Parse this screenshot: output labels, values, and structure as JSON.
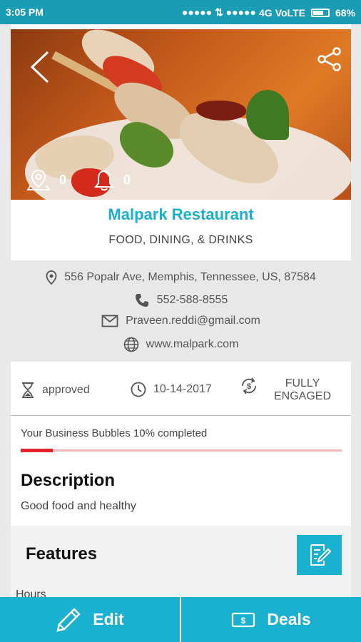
{
  "status_bar": {
    "time": "3:05 PM",
    "signal": "●●●●● ⇅ ●●●●●",
    "network": "4G",
    "volte": "VoLTE",
    "battery": "68%"
  },
  "hero": {
    "location_count": "0",
    "notification_count": "0"
  },
  "business": {
    "name": "Malpark Restaurant",
    "category": "FOOD, DINING, & DRINKS",
    "address": "556 Popalr Ave, Memphis, Tennessee, US, 87584",
    "phone": "552-588-8555",
    "email": "Praveen.reddi@gmail.com",
    "website": "www.malpark.com"
  },
  "stats": {
    "status": "approved",
    "date": "10-14-2017",
    "engagement_line1": "FULLY",
    "engagement_line2": "ENGAGED"
  },
  "progress": {
    "label": "Your Business Bubbles 10% completed",
    "fraction": 0.1
  },
  "description": {
    "title": "Description",
    "text": "Good food and healthy"
  },
  "features": {
    "title": "Features",
    "hours_label": "Hours"
  },
  "bottom_bar": {
    "edit_label": "Edit",
    "deals_label": "Deals"
  },
  "colors": {
    "accent": "#1ab0d0",
    "status_bar": "#1b9cb5",
    "progress_fill": "#e4242c",
    "progress_track": "#f5b6b8"
  }
}
